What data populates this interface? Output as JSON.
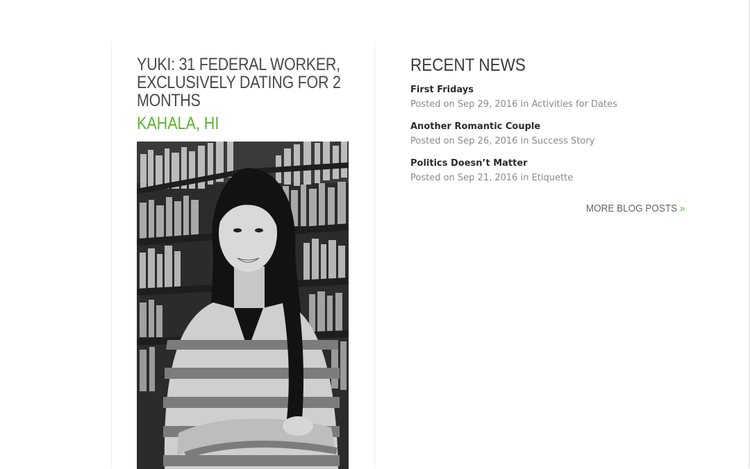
{
  "profile": {
    "title": "YUKI: 31 FEDERAL WORKER, EXCLUSIVELY DATING FOR 2 MONTHS",
    "location": "KAHALA, HI",
    "accent_color": "#5db230"
  },
  "news": {
    "heading": "RECENT NEWS",
    "posted_on": "Posted on",
    "in": "in",
    "items": [
      {
        "title": "First Fridays",
        "date": "Sep 29, 2016",
        "category": "Activities for Dates"
      },
      {
        "title": "Another Romantic Couple",
        "date": "Sep 26, 2016",
        "category": "Success Story"
      },
      {
        "title": "Politics Doesn’t Matter",
        "date": "Sep 21, 2016",
        "category": "Etiquette"
      }
    ],
    "more_label": "MORE BLOG POSTS",
    "more_icon": "»"
  }
}
